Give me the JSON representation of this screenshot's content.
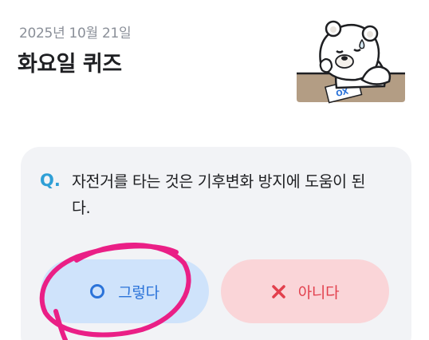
{
  "header": {
    "date": "2025년 10월 21일",
    "title": "화요일 퀴즈"
  },
  "quiz": {
    "q_label": "Q.",
    "question": "자전거를 타는 것은 기후변화 방지에 도움이 된다.",
    "answers": {
      "yes_label": "그렇다",
      "no_label": "아니다"
    }
  },
  "mascot": {
    "paper_text": "OX"
  },
  "colors": {
    "accent_blue": "#2b73d9",
    "accent_red": "#e2404d",
    "q_mark": "#2f9fd6",
    "annotation": "#ea1f86"
  },
  "icons": {
    "yes": "circle-o-icon",
    "no": "x-mark-icon"
  }
}
